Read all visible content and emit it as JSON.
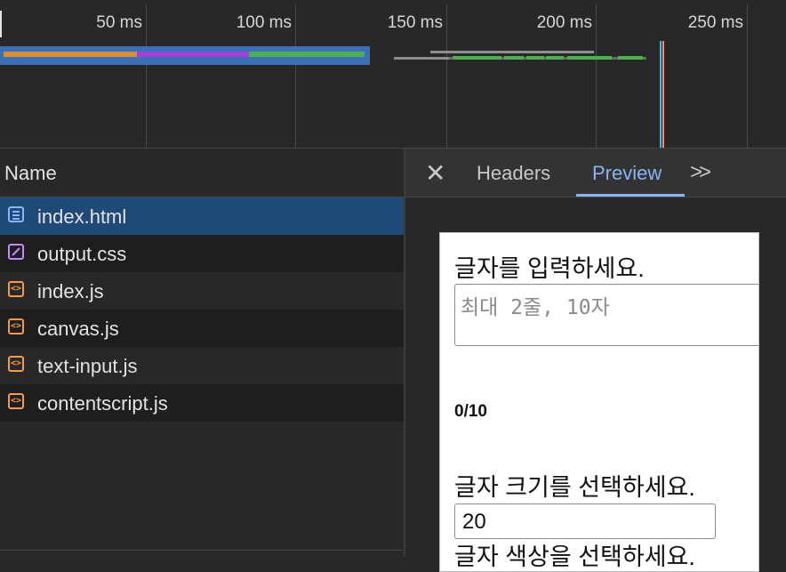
{
  "timeline": {
    "ticks": [
      "50 ms",
      "100 ms",
      "150 ms",
      "200 ms",
      "250 ms"
    ]
  },
  "requests": {
    "column_header": "Name",
    "items": [
      {
        "name": "index.html",
        "type": "document",
        "icon": "document-icon",
        "selected": true
      },
      {
        "name": "output.css",
        "type": "stylesheet",
        "icon": "stylesheet-icon"
      },
      {
        "name": "index.js",
        "type": "script",
        "icon": "script-icon"
      },
      {
        "name": "canvas.js",
        "type": "script",
        "icon": "script-icon"
      },
      {
        "name": "text-input.js",
        "type": "script",
        "icon": "script-icon"
      },
      {
        "name": "contentscript.js",
        "type": "script",
        "icon": "script-icon"
      }
    ]
  },
  "detail": {
    "close_glyph": "✕",
    "tabs": [
      {
        "label": "Headers",
        "active": false
      },
      {
        "label": "Preview",
        "active": true
      }
    ],
    "more_glyph": ">>"
  },
  "preview": {
    "prompt_text": "글자를 입력하세요.",
    "textarea_placeholder": "최대 2줄, 10자",
    "counter": "0/10",
    "size_prompt": "글자 크기를 선택하세요.",
    "size_value": "20",
    "color_prompt": "글자 색상을 선택하세요."
  },
  "colors": {
    "selected_row": "#1f4a78",
    "accent": "#8ab4f8",
    "waiting": "#d98e33",
    "receiving": "#a33ed6",
    "downloading": "#4caf50"
  }
}
